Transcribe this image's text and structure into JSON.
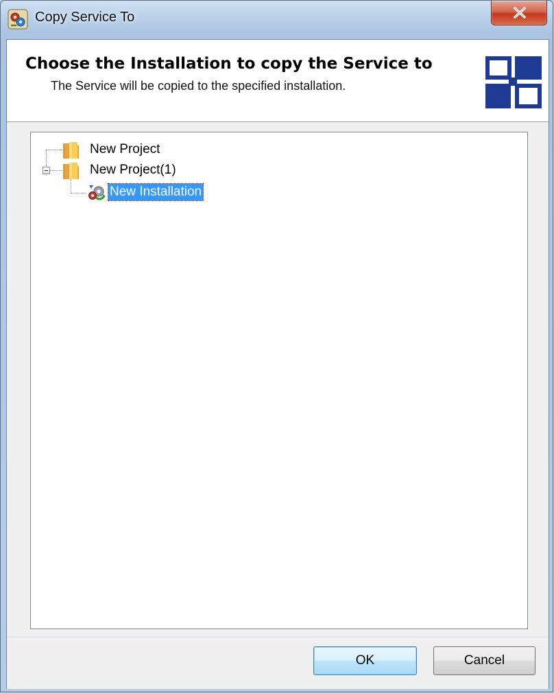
{
  "window": {
    "title": "Copy Service To",
    "title_icon": "copy-service-app-icon",
    "close_icon": "close-x-icon"
  },
  "header": {
    "title": "Choose the Installation to copy the Service to",
    "subtitle": "The Service will be copied to the specified installation.",
    "logo_icon": "brand-logo-icon",
    "logo_color": "#1f3a93"
  },
  "tree": {
    "nodes": [
      {
        "label": "New Project",
        "icon": "folder-icon",
        "level": 0,
        "expanded": false,
        "selected": false
      },
      {
        "label": "New Project(1)",
        "icon": "folder-icon",
        "level": 0,
        "expanded": true,
        "selected": false
      },
      {
        "label": "New Installation",
        "icon": "installation-gear-icon",
        "level": 1,
        "selected": true
      }
    ]
  },
  "buttons": {
    "ok_label": "OK",
    "cancel_label": "Cancel"
  },
  "colors": {
    "selection": "#3399ff",
    "close_button": "#c4391f"
  }
}
